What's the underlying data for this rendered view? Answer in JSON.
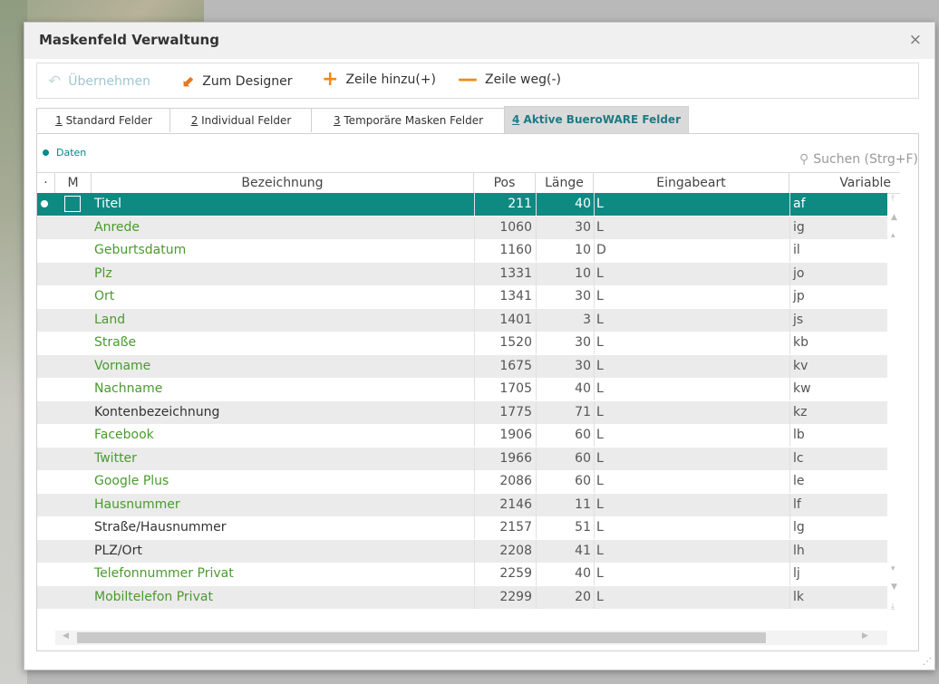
{
  "dialog": {
    "title": "Maskenfeld Verwaltung",
    "close_glyph": "×"
  },
  "toolbar": {
    "apply": "Übernehmen",
    "designer": "Zum Designer",
    "add_row": "Zeile hinzu(+)",
    "remove_row": "Zeile weg(-)"
  },
  "tabs": [
    {
      "num": "1",
      "label": " Standard Felder"
    },
    {
      "num": "2",
      "label": " Individual Felder"
    },
    {
      "num": "3",
      "label": " Temporäre Masken Felder"
    },
    {
      "num": "4",
      "label": " Aktive BueroWARE Felder"
    }
  ],
  "legend": {
    "label": "Daten"
  },
  "search": {
    "label": "Suchen (Strg+F)"
  },
  "columns": {
    "sel": "·",
    "m": "M",
    "bezeichnung": "Bezeichnung",
    "pos": "Pos",
    "laenge": "Länge",
    "eingabeart": "Eingabeart",
    "variable": "Variable"
  },
  "rows": [
    {
      "bez": "Titel",
      "pos": "211",
      "len": "40",
      "ein": "L",
      "var": "af"
    },
    {
      "bez": "Anrede",
      "pos": "1060",
      "len": "30",
      "ein": "L",
      "var": "ig"
    },
    {
      "bez": "Geburtsdatum",
      "pos": "1160",
      "len": "10",
      "ein": "D",
      "var": "il"
    },
    {
      "bez": "Plz",
      "pos": "1331",
      "len": "10",
      "ein": "L",
      "var": "jo"
    },
    {
      "bez": "Ort",
      "pos": "1341",
      "len": "30",
      "ein": "L",
      "var": "jp"
    },
    {
      "bez": "Land",
      "pos": "1401",
      "len": "3",
      "ein": "L",
      "var": "js"
    },
    {
      "bez": "Straße",
      "pos": "1520",
      "len": "30",
      "ein": "L",
      "var": "kb"
    },
    {
      "bez": "Vorname",
      "pos": "1675",
      "len": "30",
      "ein": "L",
      "var": "kv"
    },
    {
      "bez": "Nachname",
      "pos": "1705",
      "len": "40",
      "ein": "L",
      "var": "kw"
    },
    {
      "bez": "Kontenbezeichnung",
      "pos": "1775",
      "len": "71",
      "ein": "L",
      "var": "kz"
    },
    {
      "bez": "Facebook",
      "pos": "1906",
      "len": "60",
      "ein": "L",
      "var": "lb"
    },
    {
      "bez": "Twitter",
      "pos": "1966",
      "len": "60",
      "ein": "L",
      "var": "lc"
    },
    {
      "bez": "Google Plus",
      "pos": "2086",
      "len": "60",
      "ein": "L",
      "var": "le"
    },
    {
      "bez": "Hausnummer",
      "pos": "2146",
      "len": "11",
      "ein": "L",
      "var": "lf"
    },
    {
      "bez": "Straße/Hausnummer",
      "pos": "2157",
      "len": "51",
      "ein": "L",
      "var": "lg"
    },
    {
      "bez": "PLZ/Ort",
      "pos": "2208",
      "len": "41",
      "ein": "L",
      "var": "lh"
    },
    {
      "bez": "Telefonnummer Privat",
      "pos": "2259",
      "len": "40",
      "ein": "L",
      "var": "lj"
    },
    {
      "bez": "Mobiltelefon Privat",
      "pos": "2299",
      "len": "20",
      "ein": "L",
      "var": "lk"
    }
  ],
  "colors": {
    "accent": "#0f8a83",
    "green_text": "#4a9a2e",
    "orange": "#f08a1a"
  }
}
